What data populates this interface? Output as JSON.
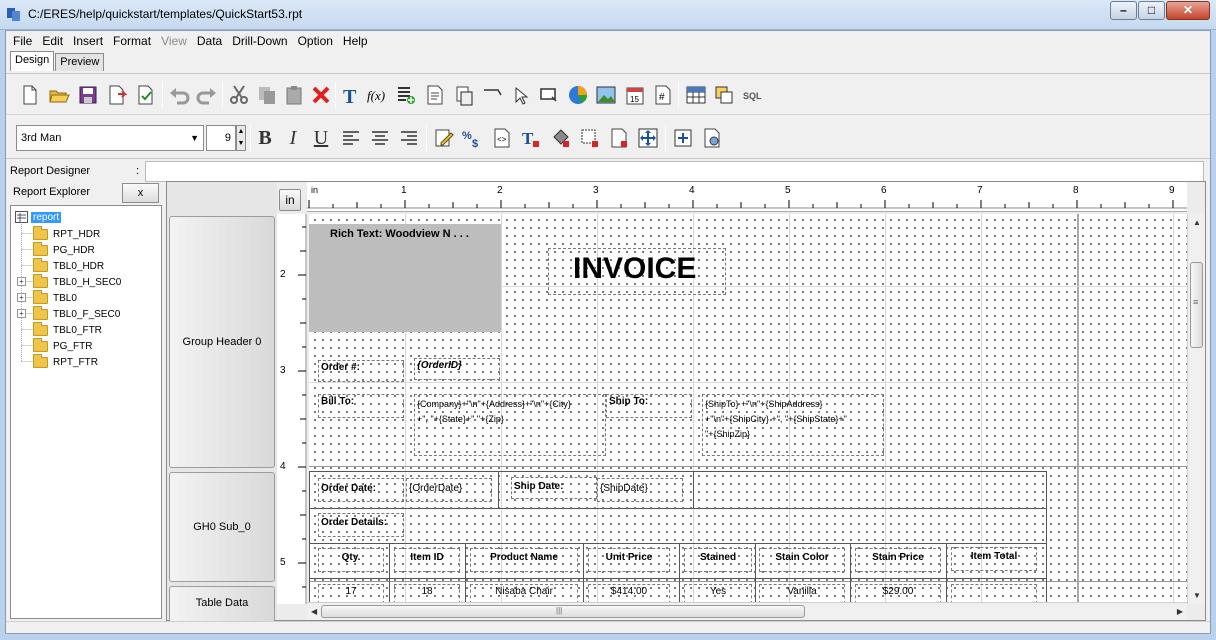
{
  "window": {
    "title": "C:/ERES/help/quickstart/templates/QuickStart53.rpt",
    "minimize": "–",
    "maximize": "□",
    "close": "✕"
  },
  "menu": [
    "File",
    "Edit",
    "Insert",
    "Format",
    "View",
    "Data",
    "Drill-Down",
    "Option",
    "Help"
  ],
  "menu_disabled": [
    "View"
  ],
  "tabs": [
    "Design",
    "Preview"
  ],
  "active_tab": "Design",
  "toolbar1_icons": [
    "new-icon",
    "open-icon",
    "save-icon",
    "export-icon",
    "publish-icon",
    "undo-icon",
    "redo-icon",
    "cut-icon",
    "copy-icon",
    "paste-icon",
    "delete-icon",
    "text-icon",
    "formula-icon",
    "add-section-icon",
    "page-icon",
    "subreport-icon",
    "line-icon",
    "pointer-icon",
    "rectangle-icon",
    "chart-icon",
    "image-icon",
    "date-icon",
    "page-number-icon",
    "table-icon",
    "crosstab-icon",
    "sql-icon"
  ],
  "font": {
    "name": "3rd Man",
    "size": "9"
  },
  "format_buttons": {
    "bold": "B",
    "italic": "I",
    "underline": "U"
  },
  "toolbar2_icons": [
    "align-left-icon",
    "align-center-icon",
    "align-right-icon",
    "edit-icon",
    "percent-currency-icon",
    "code-icon",
    "text-color-icon",
    "fill-color-icon",
    "border-icon",
    "field-border-icon",
    "move-icon",
    "fit-icon",
    "settings-icon"
  ],
  "designer": {
    "label": "Report Designer",
    "colon": ":",
    "value": ""
  },
  "explorer": {
    "title": "Report Explorer",
    "close": "x",
    "root": "report",
    "nodes": [
      {
        "label": "RPT_HDR",
        "expandable": false
      },
      {
        "label": "PG_HDR",
        "expandable": false
      },
      {
        "label": "TBL0_HDR",
        "expandable": false
      },
      {
        "label": "TBL0_H_SEC0",
        "expandable": true
      },
      {
        "label": "TBL0",
        "expandable": true
      },
      {
        "label": "TBL0_F_SEC0",
        "expandable": true
      },
      {
        "label": "TBL0_FTR",
        "expandable": false
      },
      {
        "label": "PG_FTR",
        "expandable": false
      },
      {
        "label": "RPT_FTR",
        "expandable": false
      }
    ]
  },
  "bands": [
    "Group Header 0",
    "GH0 Sub_0",
    "Table Data"
  ],
  "unit_button": "in",
  "ruler": {
    "unit": "in",
    "h_ticks": [
      "1",
      "2",
      "3",
      "4",
      "5",
      "6",
      "7",
      "8",
      "9"
    ],
    "v_ticks": [
      "2",
      "3",
      "4",
      "5"
    ]
  },
  "canvas": {
    "rich_text": "Rich Text: Woodview N . . .",
    "invoice_title": "INVOICE",
    "order_label": "Order #:",
    "order_value": "{OrderID}",
    "bill_to_label": "Bill To:",
    "bill_to_value_1": "{Company}+\"\\n\"+{Address}+\"\\n\"+{City}",
    "bill_to_value_2": "+\", \"+{State}+\" \"+{Zip}",
    "ship_to_label": "Ship To:",
    "ship_to_value_1": "{ShipTo} +\"\\n\"+{ShipAddress}",
    "ship_to_value_2": "+\"\\n\"+{ShipCity} +\", \"+{ShipState}+\"",
    "ship_to_value_3": "\"+{ShipZip}",
    "order_date_label": "Order Date:",
    "order_date_value": "{OrderDate}",
    "ship_date_label": "Ship Date:",
    "ship_date_value": "{ShipDate}",
    "order_details_label": "Order Details:",
    "columns": [
      "Qty.",
      "Item ID",
      "Product Name",
      "Unit Price",
      "Stained",
      "Stain Color",
      "Stain Price",
      "Item Total"
    ],
    "row": [
      "17",
      "18",
      "Nisaba Chair",
      "$414.00",
      "Yes",
      "Vanilla",
      "$29.00",
      ""
    ]
  },
  "scrollbar": {
    "grip": "≡",
    "hgrip": "|||"
  }
}
